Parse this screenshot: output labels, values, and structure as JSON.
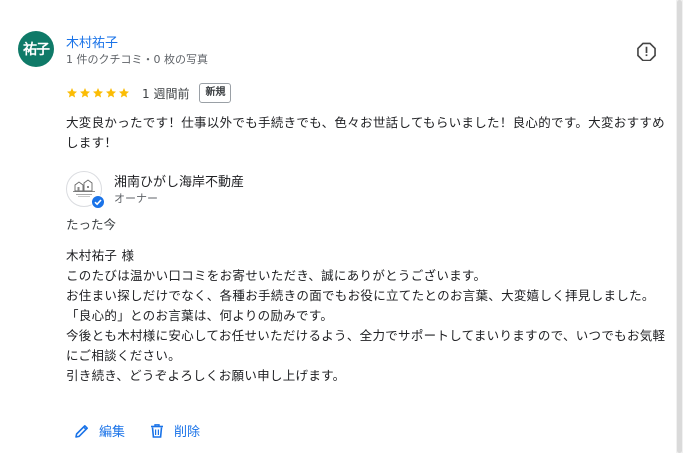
{
  "reviewer": {
    "avatar_text": "祐子",
    "name": "木村祐子",
    "meta": "1 件のクチコミ・0 枚の写真"
  },
  "review": {
    "stars_filled": 5,
    "stars_total": 5,
    "date": "1 週間前",
    "badge": "新規",
    "text": "大変良かったです！仕事以外でも手続きでも、色々お世話してもらいました！良心的です。大変おすすめします！"
  },
  "owner": {
    "name": "湘南ひがし海岸不動産",
    "role": "オーナー",
    "reply_time": "たった今",
    "reply_lines": [
      "木村祐子 様",
      "このたびは温かい口コミをお寄せいただき、誠にありがとうございます。",
      "お住まい探しだけでなく、各種お手続きの面でもお役に立てたとのお言葉、大変嬉しく拝見しました。",
      "「良心的」とのお言葉は、何よりの励みです。",
      "今後とも木村様に安心してお任せいただけるよう、全力でサポートしてまいりますので、いつでもお気軽にご相談ください。",
      "引き続き、どうぞよろしくお願い申し上げます。"
    ]
  },
  "actions": {
    "edit_label": "編集",
    "delete_label": "削除"
  },
  "icons": {
    "report": "report-icon",
    "star": "star-icon",
    "verified": "verified-check-icon",
    "edit": "pencil-icon",
    "delete": "trash-icon"
  },
  "colors": {
    "avatar_bg": "#0f7a68",
    "link_blue": "#1a73e8",
    "star_gold": "#fbbc04",
    "verified_blue": "#1a73e8"
  }
}
